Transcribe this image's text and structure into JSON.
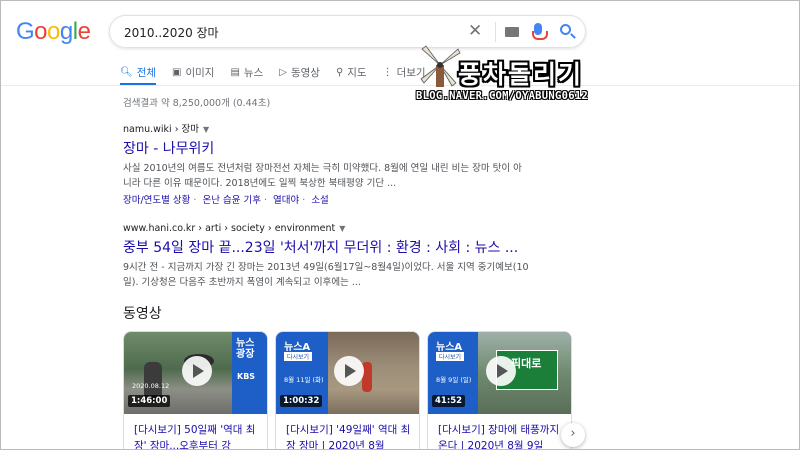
{
  "logo": "Google",
  "search": {
    "query": "2010..2020 장마"
  },
  "tabs": [
    {
      "label": "전체",
      "icon": "search-icon"
    },
    {
      "label": "이미지",
      "icon": "image-icon"
    },
    {
      "label": "뉴스",
      "icon": "news-icon"
    },
    {
      "label": "동영상",
      "icon": "video-icon"
    },
    {
      "label": "지도",
      "icon": "map-pin-icon"
    },
    {
      "label": "더보기",
      "icon": "more-vert-icon"
    }
  ],
  "watermark": {
    "title": "풍차돌리기",
    "url": "BLOG.NAVER.COM/OYABUNG0612"
  },
  "stats": "검색결과 약 8,250,000개 (0.44초)",
  "results": [
    {
      "cite": "namu.wiki › 장마",
      "title": "장마 - 나무위키",
      "snippet1": "사실 2010년의 여름도 전년처럼 장마전선 자체는 극히 미약했다. 8월에 연일 내린 비는 장마 탓이 아",
      "snippet2": "니라 다른 이유 때문이다. 2018년에도 일찍 북상한 북태평양 기단 ...",
      "sitelinks": [
        "장마/연도별 상황",
        "온난 습윤 기후",
        "열대야",
        "소설"
      ]
    },
    {
      "cite": "www.hani.co.kr › arti › society › environment",
      "title": "중부 54일 장마 끝...23일 '처서'까지 무더위 : 환경 : 사회 : 뉴스 ...",
      "snippet1": "9시간 전 - 지금까지 가장 긴 장마는 2013년 49일(6월17일~8월4일)이었다. 서울 지역 중기예보(10",
      "snippet2": "일). 기상청은 다음주 초반까지 폭염이 계속되고 이후에는 ..."
    }
  ],
  "videos": {
    "heading": "동영상",
    "items": [
      {
        "duration": "1:46:00",
        "title": "[다시보기] 50일째 '역대 최장' 장마...오후부터 강",
        "brand": "뉴스 광장",
        "sub": "KBS",
        "date": "2020.08.12"
      },
      {
        "duration": "1:00:32",
        "title": "[다시보기] '49일째' 역대 최장 장마 | 2020년 8월",
        "brand": "뉴스A",
        "sub": "다시보기",
        "date": "8월 11일 (화)"
      },
      {
        "duration": "41:52",
        "title": "[다시보기] 장마에 태풍까지 온다 | 2020년 8월 9일",
        "brand": "뉴스A",
        "sub": "다시보기",
        "date": "8월 9일 (일)",
        "sign": "픽대로"
      }
    ]
  }
}
